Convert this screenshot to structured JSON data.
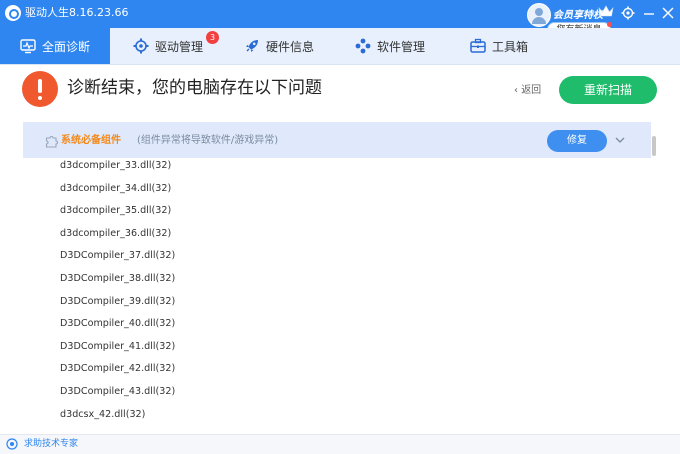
{
  "titlebar": {
    "app_title": "驱动人生8.16.23.66",
    "vip_label": "会员享特权",
    "notice_text": "您有新消息"
  },
  "nav": {
    "tabs": [
      {
        "label": "全面诊断",
        "icon": "monitor-icon",
        "active": true
      },
      {
        "label": "驱动管理",
        "icon": "gear-icon",
        "badge": "3"
      },
      {
        "label": "硬件信息",
        "icon": "rocket-icon"
      },
      {
        "label": "软件管理",
        "icon": "apps-icon"
      },
      {
        "label": "工具箱",
        "icon": "toolbox-icon"
      }
    ]
  },
  "header": {
    "result_title": "诊断结束，您的电脑存在以下问题",
    "back_label": "返回",
    "rescan_label": "重新扫描"
  },
  "group": {
    "title": "系统必备组件",
    "description": "(组件异常将导致软件/游戏异常)",
    "repair_label": "修复"
  },
  "items": [
    "d3dcompiler_33.dll(32)",
    "d3dcompiler_34.dll(32)",
    "d3dcompiler_35.dll(32)",
    "d3dcompiler_36.dll(32)",
    "D3DCompiler_37.dll(32)",
    "D3DCompiler_38.dll(32)",
    "D3DCompiler_39.dll(32)",
    "D3DCompiler_40.dll(32)",
    "D3DCompiler_41.dll(32)",
    "D3DCompiler_42.dll(32)",
    "D3DCompiler_43.dll(32)",
    "d3dcsx_42.dll(32)"
  ],
  "footer": {
    "help_label": "求助技术专家"
  },
  "colors": {
    "brand_blue": "#2f86f0",
    "success_green": "#1fbd6b",
    "warning_orange": "#f0582e",
    "group_title_orange": "#f28a1c"
  }
}
